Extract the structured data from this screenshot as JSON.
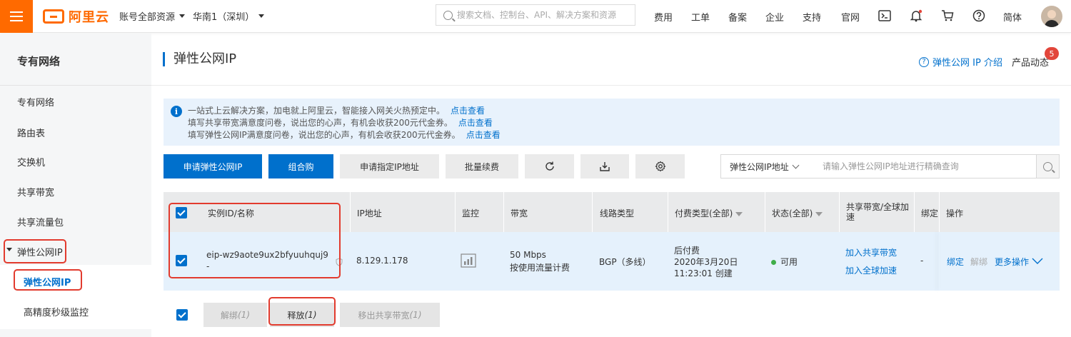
{
  "topbar": {
    "logo_text": "阿里云",
    "account_label": "账号全部资源",
    "region_label": "华南1（深圳）",
    "search_placeholder": "搜索文档、控制台、API、解决方案和资源",
    "nav": [
      "费用",
      "工单",
      "备案",
      "企业",
      "支持",
      "官网"
    ],
    "lang": "简体"
  },
  "sidebar": {
    "title": "专有网络",
    "items": [
      {
        "label": "专有网络"
      },
      {
        "label": "路由表"
      },
      {
        "label": "交换机"
      },
      {
        "label": "共享带宽"
      },
      {
        "label": "共享流量包"
      },
      {
        "label": "弹性公网IP"
      }
    ],
    "sub_items": [
      {
        "label": "弹性公网IP"
      },
      {
        "label": "高精度秒级监控"
      }
    ]
  },
  "header": {
    "title": "弹性公网IP",
    "help_link": "弹性公网 IP 介绍",
    "product_news": "产品动态",
    "badge_count": "5"
  },
  "notice": {
    "lines": [
      {
        "text": "一站式上云解决方案，加电就上阿里云，智能接入网关火热预定中。",
        "link": "点击查看"
      },
      {
        "text": "填写共享带宽满意度问卷，说出您的心声，有机会收获200元代金券。",
        "link": "点击查看"
      },
      {
        "text": "填写弹性公网IP满意度问卷，说出您的心声，有机会收获200元代金券。",
        "link": "点击查看"
      }
    ]
  },
  "toolbar": {
    "apply_eip": "申请弹性公网IP",
    "combo_buy": "组合购",
    "apply_specific": "申请指定IP地址",
    "batch_renew": "批量续费",
    "filter_field": "弹性公网IP地址",
    "filter_placeholder": "请输入弹性公网IP地址进行精确查询"
  },
  "table": {
    "headers": {
      "instance": "实例ID/名称",
      "ip": "IP地址",
      "monitor": "监控",
      "bandwidth": "带宽",
      "line_type": "线路类型",
      "billing": "付费类型(全部)",
      "status": "状态(全部)",
      "shared_bw": "共享带宽/全球加速",
      "bind": "绑定",
      "ops": "操作"
    },
    "rows": [
      {
        "instance_id": "eip-wz9aote9ux2bfyuuhquj9",
        "name": "-",
        "ip": "8.129.1.178",
        "bandwidth": "50 Mbps",
        "bandwidth_billing": "按使用流量计费",
        "line_type": "BGP（多线）",
        "billing_type": "后付费",
        "billing_date": "2020年3月20日",
        "billing_time": "11:23:01 创建",
        "status": "可用",
        "join_shared_bw": "加入共享带宽",
        "join_global_accel": "加入全球加速",
        "bind_value": "-",
        "op_bind": "绑定",
        "op_unbind": "解绑",
        "op_more": "更多操作"
      }
    ]
  },
  "bulk": {
    "unbind": "解绑",
    "unbind_count": "(1)",
    "release": "释放",
    "release_count": "(1)",
    "remove_shared": "移出共享带宽",
    "remove_shared_count": "(1)"
  },
  "colors": {
    "brand": "#ff6a00",
    "primary": "#0070cc",
    "highlight": "#e23b2e",
    "status_ok": "#3fae49"
  }
}
